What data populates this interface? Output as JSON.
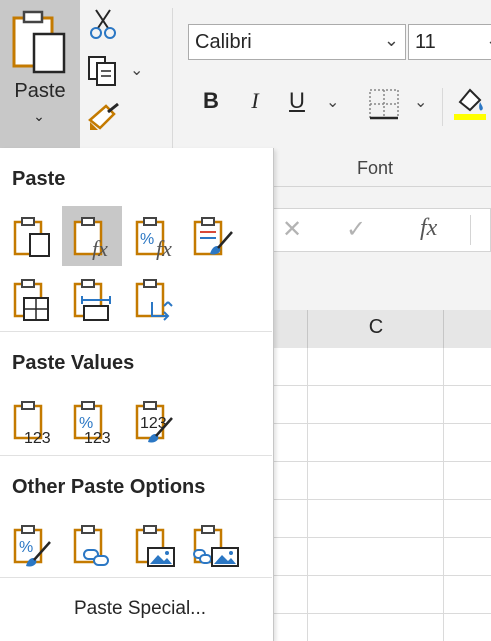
{
  "ribbon": {
    "paste_label": "Paste",
    "font_name": "Calibri",
    "font_size": "11",
    "font_group_label": "Font",
    "bold": "B",
    "italic": "I",
    "underline": "U"
  },
  "formula_bar": {
    "cancel_glyph": "✕",
    "enter_glyph": "✓",
    "fx_glyph": "fx"
  },
  "grid": {
    "column_c": "C"
  },
  "menu": {
    "paste_title": "Paste",
    "paste_values_title": "Paste Values",
    "other_title": "Other Paste Options",
    "paste_special": "Paste Special...",
    "values_icon_text": "123",
    "percent_text": "%"
  },
  "colors": {
    "clipboard_orange": "#c47a00",
    "accent_blue": "#2b77c4",
    "hover_gray": "#c8c8c8",
    "highlight_yellow": "#ffff00"
  }
}
